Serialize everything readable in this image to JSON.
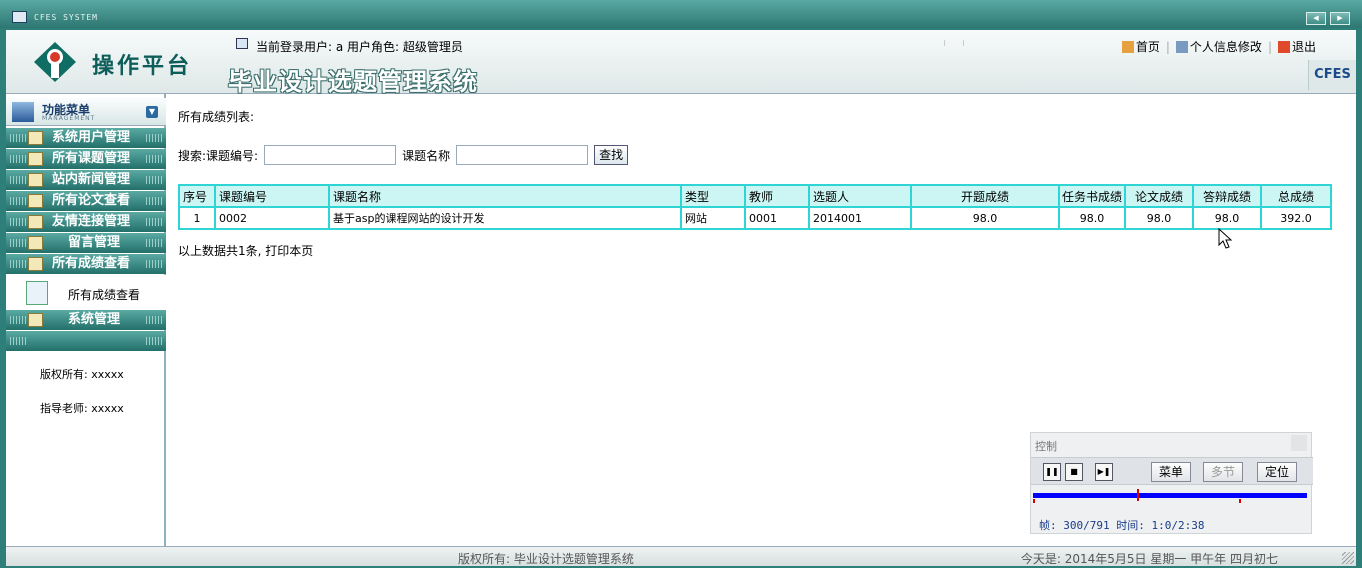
{
  "window": {
    "title": "CFES SYSTEM"
  },
  "header": {
    "brand": "操作平台",
    "system_title": "毕业设计选题管理系统",
    "corner": "CFES",
    "user_info": "当前登录用户: a  用户角色: 超级管理员",
    "links": {
      "home": "首页",
      "profile": "个人信息修改",
      "logout": "退出"
    }
  },
  "sidebar": {
    "menu_title": "功能菜单",
    "menu_subtitle": "MANAGEMENT",
    "items": [
      {
        "label": "系统用户管理"
      },
      {
        "label": "所有课题管理"
      },
      {
        "label": "站内新闻管理"
      },
      {
        "label": "所有论文查看"
      },
      {
        "label": "友情连接管理"
      },
      {
        "label": "留言管理"
      },
      {
        "label": "所有成绩查看"
      },
      {
        "label": "系统管理"
      }
    ],
    "active_sub": "所有成绩查看",
    "copyright": "版权所有: xxxxx",
    "advisor": "指导老师: xxxxx"
  },
  "main": {
    "title": "所有成绩列表:",
    "search": {
      "label": "搜索:课题编号:",
      "name_label": "课题名称",
      "button": "查找"
    },
    "table": {
      "headers": [
        "序号",
        "课题编号",
        "课题名称",
        "类型",
        "教师",
        "选题人",
        "开题成绩",
        "任务书成绩",
        "论文成绩",
        "答辩成绩",
        "总成绩"
      ],
      "rows": [
        [
          "1",
          "0002",
          "基于asp的课程网站的设计开发",
          "网站",
          "0001",
          "2014001",
          "98.0",
          "98.0",
          "98.0",
          "98.0",
          "392.0"
        ]
      ]
    },
    "summary": "以上数据共1条, 打印本页"
  },
  "footer": {
    "copyright": "版权所有: 毕业设计选题管理系统",
    "date": "今天是: 2014年5月5日 星期一 甲午年 四月初七"
  },
  "player": {
    "title": "控制",
    "menu": "菜单",
    "multi": "多节",
    "locate": "定位",
    "progress": 0.38,
    "info": "帧: 300/791 时间: 1:0/2:38"
  }
}
